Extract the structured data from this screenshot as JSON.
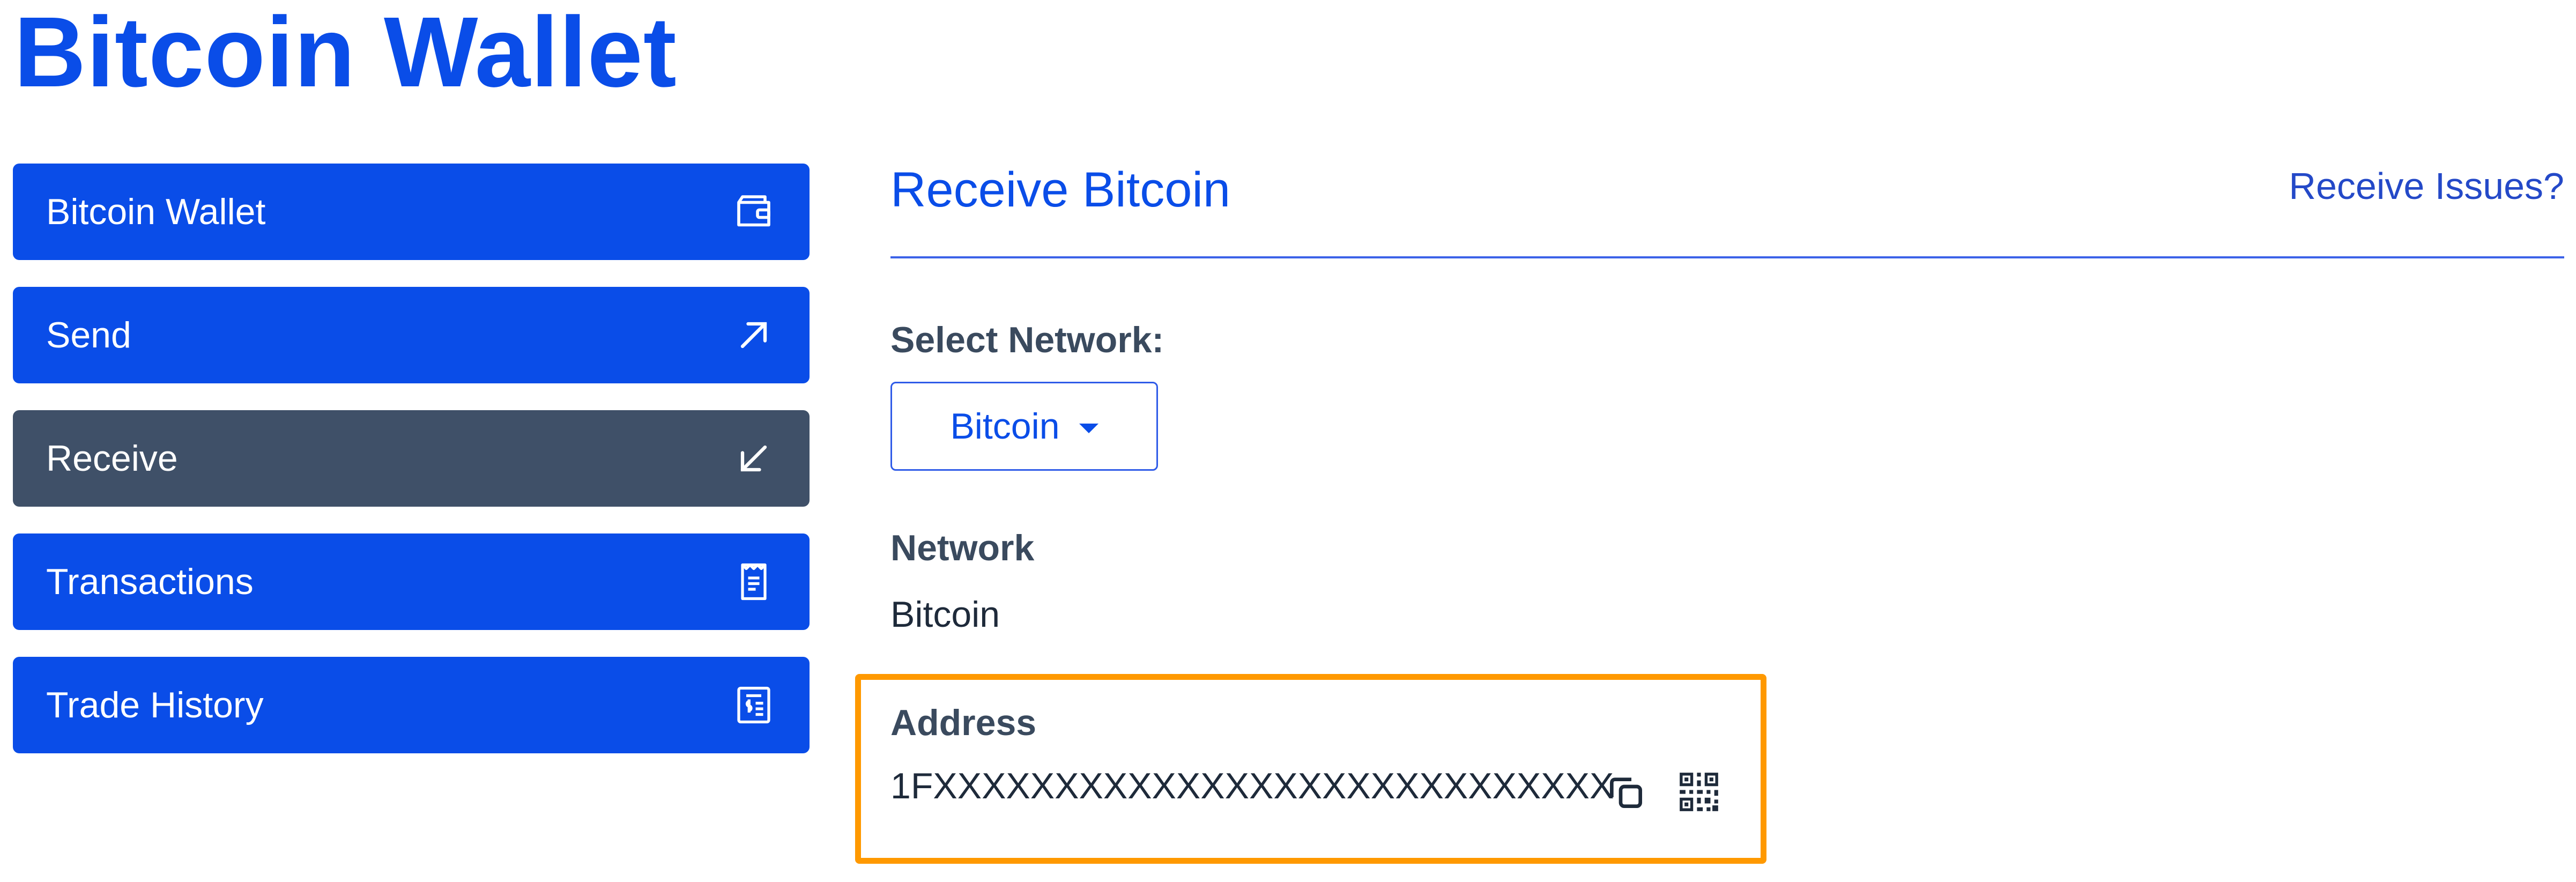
{
  "app": {
    "title": "Bitcoin Wallet"
  },
  "sidebar": {
    "items": [
      {
        "label": "Bitcoin Wallet",
        "icon": "wallet-icon"
      },
      {
        "label": "Send",
        "icon": "arrow-up-right-icon"
      },
      {
        "label": "Receive",
        "icon": "arrow-down-left-icon",
        "active": true
      },
      {
        "label": "Transactions",
        "icon": "receipt-icon"
      },
      {
        "label": "Trade History",
        "icon": "ledger-icon"
      }
    ]
  },
  "main": {
    "title": "Receive Bitcoin",
    "issues_link": "Receive Issues?",
    "select_network": {
      "label": "Select Network:",
      "value": "Bitcoin"
    },
    "network": {
      "label": "Network",
      "value": "Bitcoin"
    },
    "address": {
      "label": "Address",
      "value": "1FXXXXXXXXXXXXXXXXXXXXXXXXXXXX"
    }
  },
  "colors": {
    "accent": "#0a4de8",
    "active_nav": "#3f5068",
    "highlight": "#ff9900"
  }
}
